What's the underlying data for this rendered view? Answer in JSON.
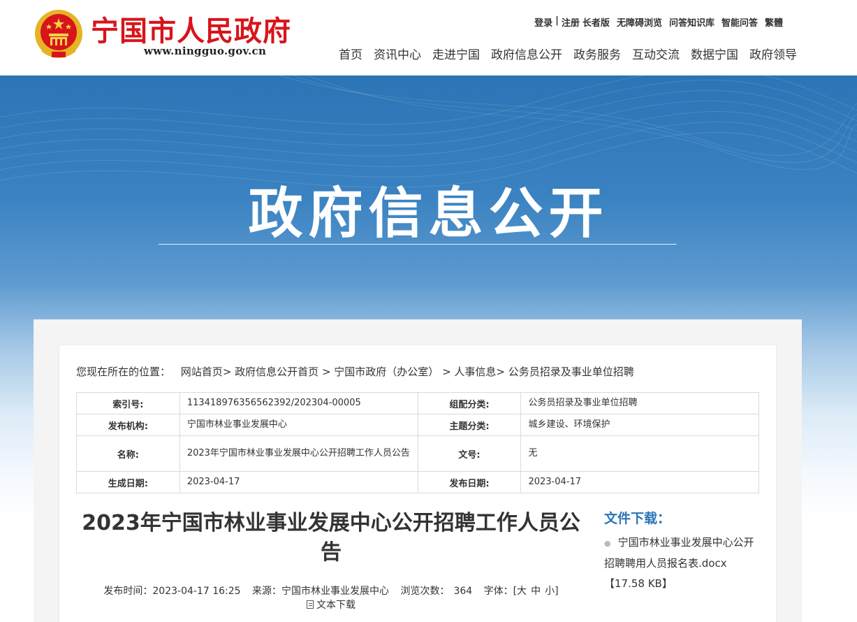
{
  "header": {
    "site_title": "宁国市人民政府",
    "site_url": "www.ningguo.gov.cn",
    "top_links": [
      "登录",
      "注册",
      "长者版",
      "无障碍浏览",
      "问答知识库",
      "智能问答",
      "繁體"
    ],
    "nav": [
      "首页",
      "资讯中心",
      "走进宁国",
      "政府信息公开",
      "政务服务",
      "互动交流",
      "数据宁国",
      "政府领导"
    ]
  },
  "banner": {
    "title": "政府信息公开"
  },
  "breadcrumb": {
    "prefix": "您现在所在的位置：",
    "items": [
      "网站首页",
      "政府信息公开首页",
      "宁国市政府（办公室）",
      "人事信息",
      "公务员招录及事业单位招聘"
    ]
  },
  "meta": {
    "index_label": "索引号:",
    "index_value": "113418976356562392/202304-00005",
    "category_label": "组配分类:",
    "category_value": "公务员招录及事业单位招聘",
    "publisher_label": "发布机构:",
    "publisher_value": "宁国市林业事业发展中心",
    "topic_label": "主题分类:",
    "topic_value": "城乡建设、环境保护",
    "name_label": "名称:",
    "name_value": "2023年宁国市林业事业发展中心公开招聘工作人员公告",
    "docno_label": "文号:",
    "docno_value": "无",
    "created_label": "生成日期:",
    "created_value": "2023-04-17",
    "published_label": "发布日期:",
    "published_value": "2023-04-17"
  },
  "article": {
    "title": "2023年宁国市林业事业发展中心公开招聘工作人员公告",
    "publish_time": "发布时间：2023-04-17 16:25",
    "source": "来源：宁国市林业事业发展中心",
    "views_label": "浏览次数：",
    "views": "364",
    "font_label": "字体：[",
    "font_large": "大",
    "font_medium": "中",
    "font_small": "小",
    "font_end": "]",
    "download_text": "文本下载"
  },
  "files": {
    "title": "文件下载：",
    "items": [
      {
        "name": "宁国市林业事业发展中心公开招聘聘用人员报名表.docx",
        "size": "【17.58 KB】"
      }
    ]
  },
  "colors": {
    "brand_red": "#d8141b",
    "accent_blue": "#2b74b6"
  }
}
